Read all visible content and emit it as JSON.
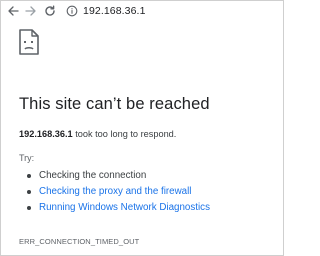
{
  "toolbar": {
    "back_icon": "arrow-left-icon",
    "forward_icon": "arrow-right-icon",
    "reload_icon": "reload-icon",
    "info_icon": "info-circle-icon",
    "url": "192.168.36.1"
  },
  "error_page": {
    "icon": "sad-page-icon",
    "title": "This site can’t be reached",
    "host": "192.168.36.1",
    "message_suffix": " took too long to respond.",
    "try_label": "Try:",
    "suggestions": [
      {
        "label": "Checking the connection",
        "is_link": false
      },
      {
        "label": "Checking the proxy and the firewall",
        "is_link": true
      },
      {
        "label": "Running Windows Network Diagnostics",
        "is_link": true
      }
    ],
    "error_code": "ERR_CONNECTION_TIMED_OUT"
  },
  "colors": {
    "link": "#1a73e8",
    "text": "#202124",
    "muted": "#5f6368"
  }
}
